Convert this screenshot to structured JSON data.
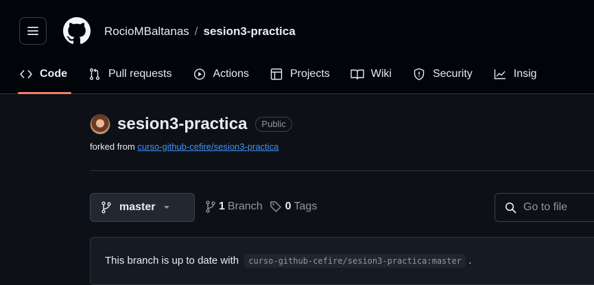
{
  "header": {
    "owner": "RocioMBaltanas",
    "separator": "/",
    "repo": "sesion3-practica"
  },
  "tabs": [
    {
      "label": "Code",
      "icon": "code-icon",
      "active": true
    },
    {
      "label": "Pull requests",
      "icon": "pull-request-icon"
    },
    {
      "label": "Actions",
      "icon": "play-circle-icon"
    },
    {
      "label": "Projects",
      "icon": "table-icon"
    },
    {
      "label": "Wiki",
      "icon": "book-icon"
    },
    {
      "label": "Security",
      "icon": "shield-icon"
    },
    {
      "label": "Insig",
      "icon": "graph-icon"
    }
  ],
  "repo": {
    "title": "sesion3-practica",
    "visibility": "Public",
    "fork_prefix": "forked from ",
    "fork_link": "curso-github-cefire/sesion3-practica"
  },
  "branch": {
    "current": "master",
    "branch_count": "1",
    "branch_label": "Branch",
    "tag_count": "0",
    "tag_label": "Tags"
  },
  "search": {
    "placeholder": "Go to file"
  },
  "status": {
    "text": "This branch is up to date with",
    "ref": "curso-github-cefire/sesion3-practica:master",
    "end": "."
  },
  "colors": {
    "accent_underline": "#f78166",
    "link": "#4493f8",
    "background": "#0d1117"
  }
}
